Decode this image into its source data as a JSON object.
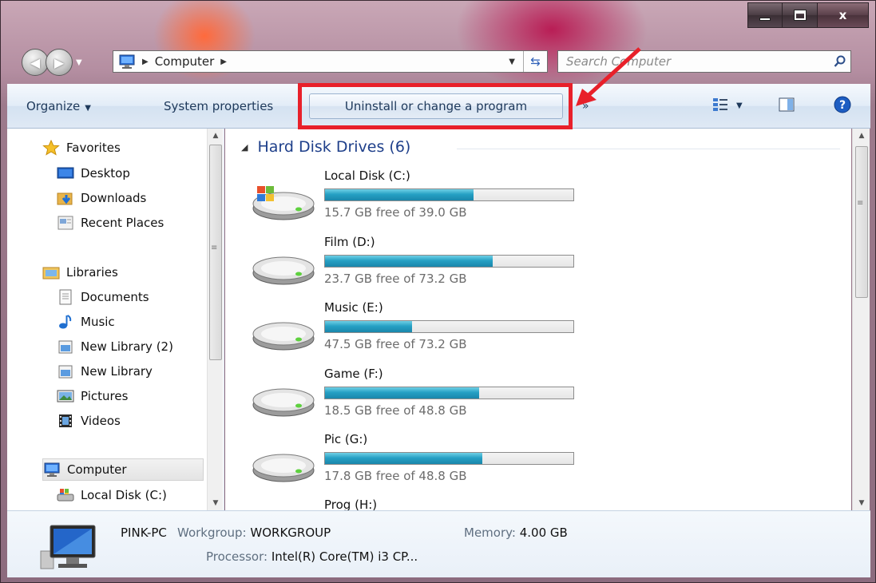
{
  "window": {
    "buttons": {
      "minimize": "minimize",
      "maximize": "maximize",
      "close": "x"
    }
  },
  "address_bar": {
    "crumbs": [
      "Computer"
    ],
    "search_placeholder": "Search Computer"
  },
  "toolbar": {
    "organize": "Organize",
    "system_properties": "System properties",
    "uninstall": "Uninstall or change a program",
    "more": "»"
  },
  "sidebar": {
    "favorites": {
      "label": "Favorites",
      "items": [
        "Desktop",
        "Downloads",
        "Recent Places"
      ]
    },
    "libraries": {
      "label": "Libraries",
      "items": [
        "Documents",
        "Music",
        "New Library (2)",
        "New Library",
        "Pictures",
        "Videos"
      ]
    },
    "computer": {
      "label": "Computer",
      "items": [
        "Local Disk (C:)"
      ]
    }
  },
  "content": {
    "group_title": "Hard Disk Drives (6)",
    "drives": [
      {
        "name": "Local Disk (C:)",
        "free_text": "15.7 GB free of 39.0 GB",
        "used_fraction": 0.597,
        "system": true
      },
      {
        "name": "Film (D:)",
        "free_text": "23.7 GB free of 73.2 GB",
        "used_fraction": 0.676,
        "system": false
      },
      {
        "name": "Music (E:)",
        "free_text": "47.5 GB free of 73.2 GB",
        "used_fraction": 0.351,
        "system": false
      },
      {
        "name": "Game (F:)",
        "free_text": "18.5 GB free of 48.8 GB",
        "used_fraction": 0.621,
        "system": false
      },
      {
        "name": "Pic (G:)",
        "free_text": "17.8 GB free of 48.8 GB",
        "used_fraction": 0.635,
        "system": false
      },
      {
        "name": "Prog (H:)",
        "free_text": "",
        "used_fraction": 0,
        "system": false
      }
    ]
  },
  "details": {
    "pc_name": "PINK-PC",
    "workgroup_label": "Workgroup:",
    "workgroup_value": "WORKGROUP",
    "memory_label": "Memory:",
    "memory_value": "4.00 GB",
    "processor_label": "Processor:",
    "processor_value": "Intel(R) Core(TM) i3 CP..."
  },
  "colors": {
    "highlight": "#e8202a",
    "drive_bar": "#26a0c4",
    "group_title": "#1e3f8a"
  },
  "icons": {
    "organize_caret": "chevron-down-icon",
    "views": "view-options-icon",
    "preview": "preview-pane-icon",
    "help": "help-icon"
  }
}
